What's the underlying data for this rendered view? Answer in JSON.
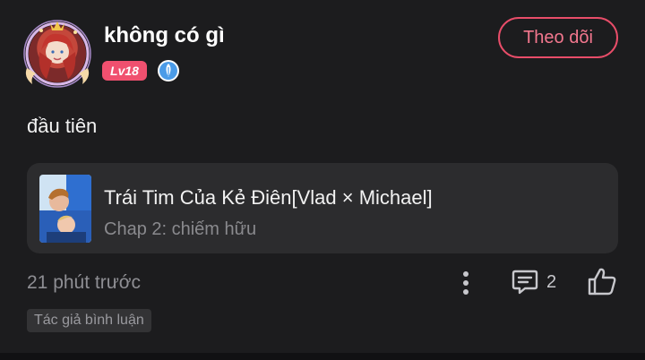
{
  "comment": {
    "author": {
      "name": "không có gì",
      "level": "Lv18",
      "follow_label": "Theo dõi"
    },
    "text": "đầu tiên",
    "book": {
      "title": "Trái Tim Của Kẻ Điên[Vlad × Michael]",
      "chapter": "Chap 2: chiếm hữu"
    },
    "timestamp": "21 phút trước",
    "reply_count": "2",
    "author_tag": "Tác giả bình luận"
  },
  "colors": {
    "background": "#1c1c1e",
    "card": "#2c2c2e",
    "accent": "#e84d69",
    "level_badge": "#f0506f",
    "verify_badge": "#4a9be8"
  },
  "icons": {
    "verify": "feather-badge-icon",
    "more": "more-vertical-icon",
    "reply": "comment-bubble-icon",
    "like": "thumbs-up-icon"
  }
}
